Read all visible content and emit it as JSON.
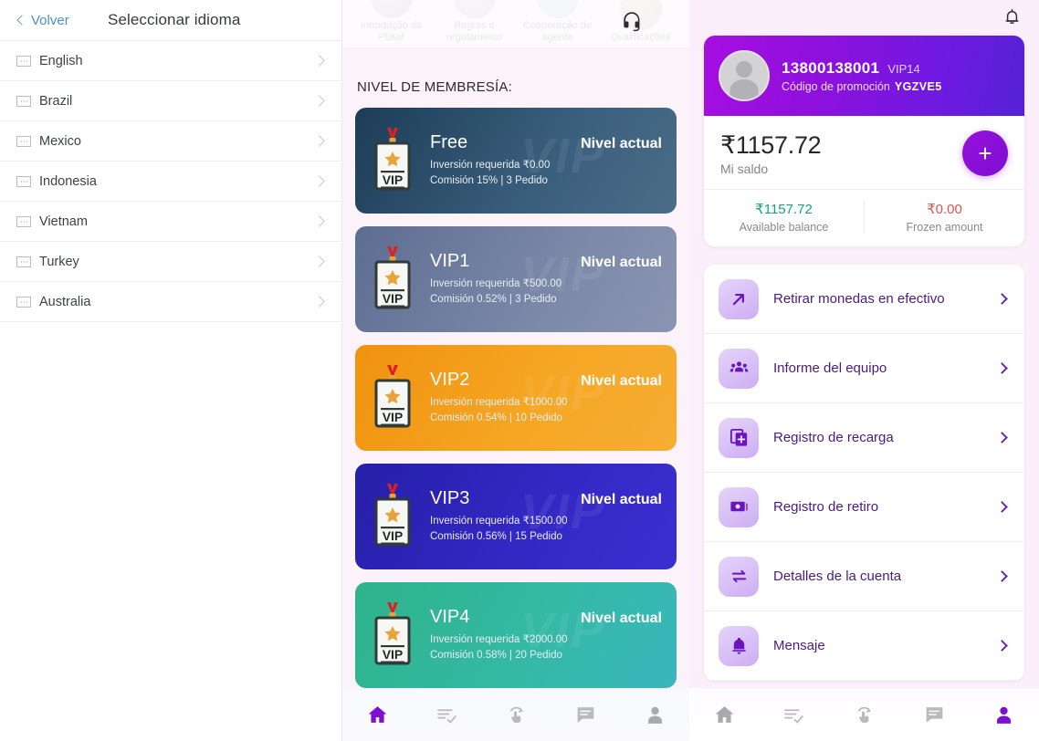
{
  "left_panel": {
    "back_label": "Volver",
    "title": "Seleccionar idioma",
    "languages": [
      {
        "name": "English"
      },
      {
        "name": "Brazil"
      },
      {
        "name": "Mexico"
      },
      {
        "name": "Indonesia"
      },
      {
        "name": "Vietnam"
      },
      {
        "name": "Turkey"
      },
      {
        "name": "Australia"
      }
    ]
  },
  "mid_panel": {
    "faded_categories": [
      {
        "label": "Introdução da Plataf"
      },
      {
        "label": "Regras e regulamento"
      },
      {
        "label": "Cooperação de agente"
      },
      {
        "label": "Qualificações"
      }
    ],
    "support_icon": "headset-icon",
    "section_title": "NIVEL DE MEMBRESÍA:",
    "vip_levels": [
      {
        "name": "Free",
        "status": "Nivel actual",
        "investment": "Inversión requerida ₹0.00",
        "commission": "Comisión 15% | 3 Pedido",
        "color": "#2e5573"
      },
      {
        "name": "VIP1",
        "status": "Nivel actual",
        "investment": "Inversión requerida ₹500.00",
        "commission": "Comisión 0.52% | 3 Pedido",
        "color": "#7b88a8"
      },
      {
        "name": "VIP2",
        "status": "Nivel actual",
        "investment": "Inversión requerida ₹1000.00",
        "commission": "Comisión 0.54% | 10 Pedido",
        "color": "#f5a623"
      },
      {
        "name": "VIP3",
        "status": "Nivel actual",
        "investment": "Inversión requerida ₹1500.00",
        "commission": "Comisión 0.56% | 15 Pedido",
        "color": "#3328c4"
      },
      {
        "name": "VIP4",
        "status": "Nivel actual",
        "investment": "Inversión requerida ₹2000.00",
        "commission": "Comisión 0.58% | 20 Pedido",
        "color": "#34b9a5"
      }
    ],
    "watermark": "VIP",
    "bottom_nav": [
      {
        "icon": "home-icon",
        "active": true
      },
      {
        "icon": "task-list-icon",
        "active": false
      },
      {
        "icon": "tap-hand-icon",
        "active": false
      },
      {
        "icon": "chat-icon",
        "active": false
      },
      {
        "icon": "person-icon",
        "active": false
      }
    ]
  },
  "right_panel": {
    "notification_icon": "bell-icon",
    "account": {
      "avatar_icon": "avatar-placeholder-icon",
      "phone": "13800138001",
      "vip_level": "VIP14",
      "promo_label": "Código de promoción",
      "promo_code": "YGZVE5",
      "balance_amount": "₹1157.72",
      "balance_label": "Mi saldo",
      "add_button_icon": "plus-icon",
      "available_value": "₹1157.72",
      "available_label": "Available balance",
      "available_color": "#16a085",
      "frozen_value": "₹0.00",
      "frozen_label": "Frozen amount",
      "frozen_color": "#e05252"
    },
    "menu": [
      {
        "label": "Retirar monedas en efectivo",
        "icon": "arrow-up-right-icon"
      },
      {
        "label": "Informe del equipo",
        "icon": "team-group-icon"
      },
      {
        "label": "Registro de recarga",
        "icon": "recharge-plus-icon"
      },
      {
        "label": "Registro de retiro",
        "icon": "cash-note-icon"
      },
      {
        "label": "Detalles de la cuenta",
        "icon": "transfer-arrows-icon"
      },
      {
        "label": "Mensaje",
        "icon": "bell-message-icon"
      }
    ],
    "bottom_nav": [
      {
        "icon": "home-icon",
        "active": false
      },
      {
        "icon": "task-list-icon",
        "active": false
      },
      {
        "icon": "tap-hand-icon",
        "active": false
      },
      {
        "icon": "chat-icon",
        "active": false
      },
      {
        "icon": "person-icon",
        "active": true
      }
    ]
  },
  "theme": {
    "accent_purple": "#7d0fd0",
    "mid_bg": "#fbf2fa",
    "right_bg": "#faeffa"
  }
}
